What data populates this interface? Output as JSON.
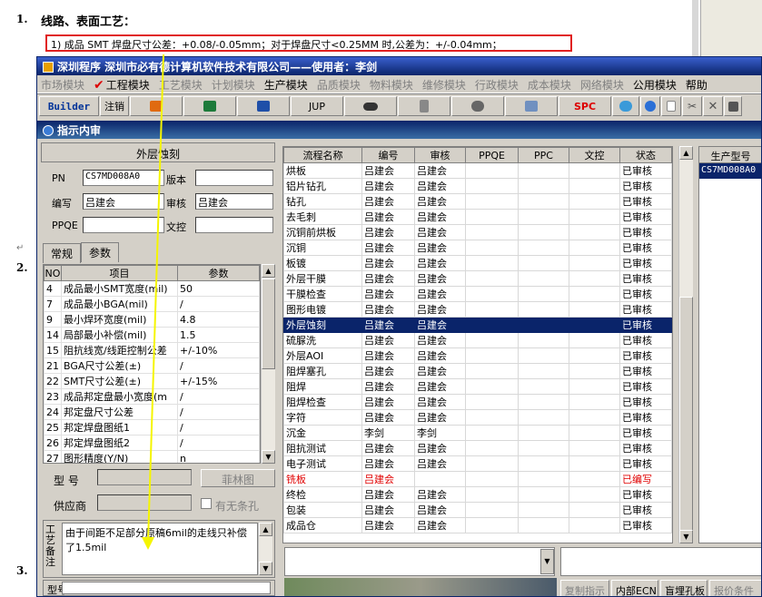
{
  "document": {
    "item1_number": "1.",
    "item1_heading": "线路、表面工艺：",
    "highlight_line": "1)  成品 SMT 焊盘尺寸公差：+0.08/-0.05mm；对于焊盘尺寸<0.25MM 时,公差为：+/-0.04mm；",
    "item2_number": "2.",
    "item3_number": "3.",
    "para_mark": "↵"
  },
  "app": {
    "title": "深圳程序   深圳市必有德计算机软件技术有限公司——使用者：李剑",
    "menu": [
      {
        "label": "市场模块",
        "enabled": false
      },
      {
        "label": "工程模块",
        "enabled": true,
        "checked": true
      },
      {
        "label": "工艺模块",
        "enabled": false
      },
      {
        "label": "计划模块",
        "enabled": false
      },
      {
        "label": "生产模块",
        "enabled": true
      },
      {
        "label": "品质模块",
        "enabled": false
      },
      {
        "label": "物料模块",
        "enabled": false
      },
      {
        "label": "维修模块",
        "enabled": false
      },
      {
        "label": "行政模块",
        "enabled": false
      },
      {
        "label": "成本模块",
        "enabled": false
      },
      {
        "label": "网络模块",
        "enabled": false
      },
      {
        "label": "公用模块",
        "enabled": true
      },
      {
        "label": "帮助",
        "enabled": true
      }
    ],
    "toolbar": {
      "builder": "Builder",
      "logout": "注销",
      "jup": "JUP",
      "spc": "SPC"
    },
    "subwindow_title": "指示内审"
  },
  "left": {
    "group_title": "外层蚀刻",
    "pn_label": "PN",
    "pn_value": "CS7MD008A0",
    "version_label": "版本",
    "version_value": "",
    "author_label": "编写",
    "author_value": "吕建会",
    "reviewer_label": "审核",
    "reviewer_value": "吕建会",
    "ppqe_label": "PPQE",
    "ppqe_value": "",
    "control_label": "文控",
    "control_value": "",
    "tab_general": "常规",
    "tab_params": "参数",
    "param_headers": [
      "NO",
      "项目",
      "参数"
    ],
    "params": [
      [
        "4",
        "成品最小SMT宽度(mil)",
        "50"
      ],
      [
        "7",
        "成品最小BGA(mil)",
        "/"
      ],
      [
        "9",
        "最小焊环宽度(mil)",
        "4.8"
      ],
      [
        "14",
        "局部最小补偿(mil)",
        "1.5"
      ],
      [
        "15",
        "阻抗线宽/线距控制公差",
        "+/-10%"
      ],
      [
        "21",
        "BGA尺寸公差(±)",
        "/"
      ],
      [
        "22",
        "SMT尺寸公差(±)",
        "+/-15%"
      ],
      [
        "23",
        "成品邦定盘最小宽度(m",
        "/"
      ],
      [
        "24",
        "邦定盘尺寸公差",
        "/"
      ],
      [
        "25",
        "邦定焊盘图纸1",
        "/"
      ],
      [
        "26",
        "邦定焊盘图纸2",
        "/"
      ],
      [
        "27",
        "图形精度(Y/N)",
        "n"
      ]
    ],
    "model_label": "型  号",
    "model_value": "",
    "film_button": "菲林图",
    "supplier_label": "供应商",
    "supplier_value": "",
    "no_slot_label": "有无条孔",
    "remark_label": "工艺备注",
    "remark_text": "由于间距不足部分原稿6mil的走线只补偿了1.5mil",
    "process_label": "型号"
  },
  "process": {
    "headers": [
      "流程名称",
      "编号",
      "审核",
      "PPQE",
      "PPC",
      "文控",
      "状态"
    ],
    "rows": [
      [
        "烘板",
        "吕建会",
        "吕建会",
        "",
        "",
        "",
        "已审核"
      ],
      [
        "铝片钻孔",
        "吕建会",
        "吕建会",
        "",
        "",
        "",
        "已审核"
      ],
      [
        "钻孔",
        "吕建会",
        "吕建会",
        "",
        "",
        "",
        "已审核"
      ],
      [
        "去毛刺",
        "吕建会",
        "吕建会",
        "",
        "",
        "",
        "已审核"
      ],
      [
        "沉铜前烘板",
        "吕建会",
        "吕建会",
        "",
        "",
        "",
        "已审核"
      ],
      [
        "沉铜",
        "吕建会",
        "吕建会",
        "",
        "",
        "",
        "已审核"
      ],
      [
        "板镀",
        "吕建会",
        "吕建会",
        "",
        "",
        "",
        "已审核"
      ],
      [
        "外层干膜",
        "吕建会",
        "吕建会",
        "",
        "",
        "",
        "已审核"
      ],
      [
        "干膜检查",
        "吕建会",
        "吕建会",
        "",
        "",
        "",
        "已审核"
      ],
      [
        "图形电镀",
        "吕建会",
        "吕建会",
        "",
        "",
        "",
        "已审核"
      ],
      [
        "外层蚀刻",
        "吕建会",
        "吕建会",
        "",
        "",
        "",
        "已审核"
      ],
      [
        "硫脲洗",
        "吕建会",
        "吕建会",
        "",
        "",
        "",
        "已审核"
      ],
      [
        "外层AOI",
        "吕建会",
        "吕建会",
        "",
        "",
        "",
        "已审核"
      ],
      [
        "阻焊塞孔",
        "吕建会",
        "吕建会",
        "",
        "",
        "",
        "已审核"
      ],
      [
        "阻焊",
        "吕建会",
        "吕建会",
        "",
        "",
        "",
        "已审核"
      ],
      [
        "阻焊检查",
        "吕建会",
        "吕建会",
        "",
        "",
        "",
        "已审核"
      ],
      [
        "字符",
        "吕建会",
        "吕建会",
        "",
        "",
        "",
        "已审核"
      ],
      [
        "沉金",
        "李剑",
        "李剑",
        "",
        "",
        "",
        "已审核"
      ],
      [
        "阻抗测试",
        "吕建会",
        "吕建会",
        "",
        "",
        "",
        "已审核"
      ],
      [
        "电子测试",
        "吕建会",
        "吕建会",
        "",
        "",
        "",
        "已审核"
      ],
      [
        "铣板",
        "吕建会",
        "",
        "",
        "",
        "",
        "已编写"
      ],
      [
        "终检",
        "吕建会",
        "吕建会",
        "",
        "",
        "",
        "已审核"
      ],
      [
        "包装",
        "吕建会",
        "吕建会",
        "",
        "",
        "",
        "已审核"
      ],
      [
        "成品仓",
        "吕建会",
        "吕建会",
        "",
        "",
        "",
        "已审核"
      ]
    ],
    "selected_index": 10,
    "red_index": 20
  },
  "side": {
    "header": "生产型号",
    "item": "CS7MD008A0"
  },
  "bottom_buttons": [
    {
      "label": "复制指示",
      "enabled": false
    },
    {
      "label": "内部ECN",
      "enabled": true
    },
    {
      "label": "盲埋孔板",
      "enabled": true
    },
    {
      "label": "报价条件",
      "enabled": false
    }
  ],
  "colors": {
    "window_bg": "#d4d0c8",
    "title_blue": "#0a246a",
    "highlight_red": "#e02020",
    "arrow_yellow": "#f5f500"
  }
}
